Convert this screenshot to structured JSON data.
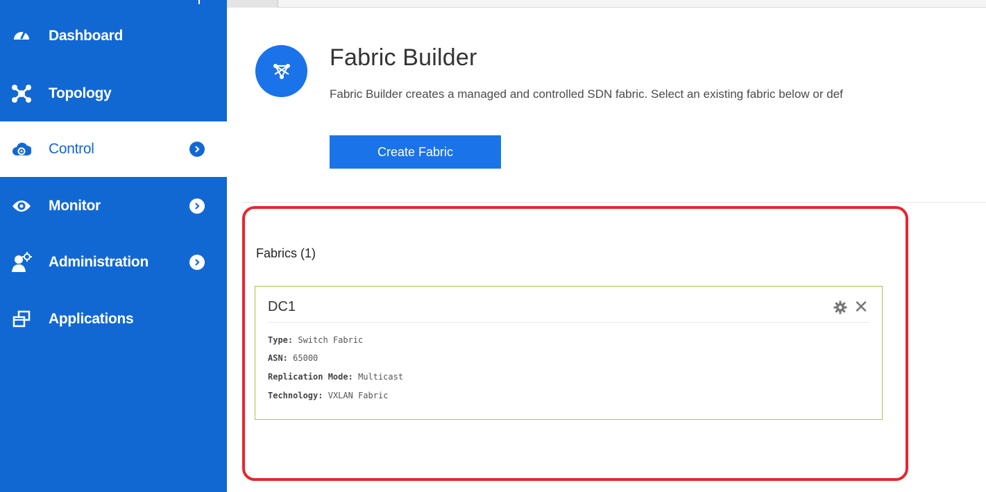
{
  "sidebar": {
    "items": [
      {
        "label": "Dashboard",
        "icon": "gauge-icon",
        "active": false,
        "has_chevron": false
      },
      {
        "label": "Topology",
        "icon": "network-topology-icon",
        "active": false,
        "has_chevron": false
      },
      {
        "label": "Control",
        "icon": "cloud-control-icon",
        "active": true,
        "has_chevron": true
      },
      {
        "label": "Monitor",
        "icon": "eye-icon",
        "active": false,
        "has_chevron": true
      },
      {
        "label": "Administration",
        "icon": "user-gear-icon",
        "active": false,
        "has_chevron": true
      },
      {
        "label": "Applications",
        "icon": "stacked-windows-icon",
        "active": false,
        "has_chevron": false
      }
    ]
  },
  "header": {
    "title": "Fabric Builder",
    "description": "Fabric Builder creates a managed and controlled SDN fabric. Select an existing fabric below or def",
    "create_button_label": "Create Fabric"
  },
  "fabrics": {
    "heading": "Fabrics (1)",
    "cards": [
      {
        "name": "DC1",
        "fields": [
          {
            "key": "Type:",
            "value": "Switch Fabric"
          },
          {
            "key": "ASN:",
            "value": "65000"
          },
          {
            "key": "Replication Mode:",
            "value": "Multicast"
          },
          {
            "key": "Technology:",
            "value": "VXLAN Fabric"
          }
        ]
      }
    ]
  },
  "colors": {
    "sidebar_bg": "#1268d3",
    "accent": "#1a73e8",
    "highlight_border": "#e8252f",
    "card_border": "#a6c34a"
  }
}
